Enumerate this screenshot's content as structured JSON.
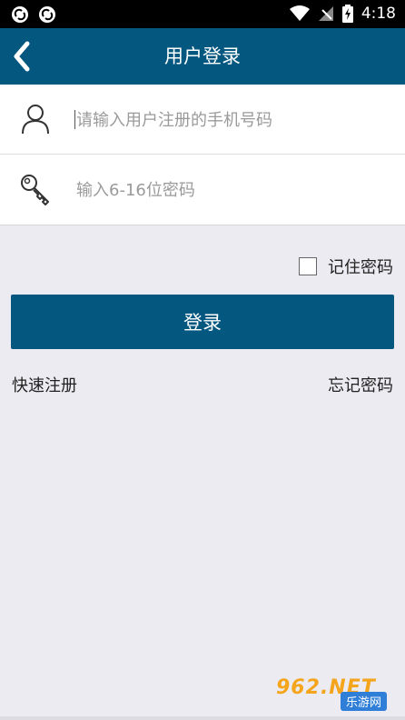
{
  "status_bar": {
    "time": "4:18",
    "left_icons": [
      "sync-icon",
      "sync-icon"
    ],
    "right_icons": [
      "wifi-icon",
      "signal-icon",
      "battery-charging-icon"
    ]
  },
  "header": {
    "title": "用户登录",
    "back_icon": "chevron-left-icon"
  },
  "form": {
    "phone_placeholder": "请输入用户注册的手机号码",
    "phone_value": "",
    "phone_icon": "user-icon",
    "password_placeholder": "输入6-16位密码",
    "password_value": "",
    "password_icon": "key-icon"
  },
  "remember": {
    "label": "记住密码",
    "checked": false
  },
  "login_button": "登录",
  "links": {
    "register": "快速注册",
    "forgot": "忘记密码"
  },
  "watermark": {
    "logo": "962",
    "suffix": ".NET",
    "tagline": "乐游网"
  },
  "colors": {
    "primary": "#04577f",
    "background": "#ebebf1",
    "status_bar": "#000000"
  }
}
